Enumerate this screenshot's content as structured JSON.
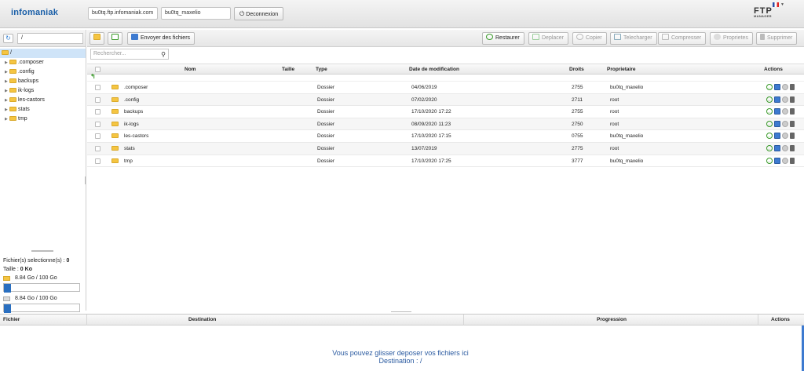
{
  "header": {
    "logo": "infomaniak",
    "host": "bu0tq.ftp.infomaniak.com",
    "user": "bu0tq_maxelio",
    "logout_label": "Deconnexion",
    "ftp_title": "FTP",
    "ftp_subtitle": "MANAGER"
  },
  "left": {
    "path": "/",
    "root_label": "/",
    "tree": [
      ".composer",
      ".config",
      "backups",
      "ik-logs",
      "les-castors",
      "stats",
      "tmp"
    ],
    "selected_label": "Fichier(s) selectionne(s) :",
    "selected_count": "0",
    "size_label": "Taille :",
    "size_value": "0 Ko",
    "quota1": "8.84 Go / 100 Go",
    "quota2": "8.84 Go / 100 Go",
    "quota1_fraction": 0.09,
    "quota2_fraction": 0.09
  },
  "toolbar": {
    "upload": "Envoyer des fichiers",
    "restore": "Restaurer",
    "move": "Deplacer",
    "copy": "Copier",
    "download": "Telecharger",
    "compress": "Compresser",
    "properties": "Proprietes",
    "delete": "Supprimer"
  },
  "search": {
    "placeholder": "Rechercher..."
  },
  "columns": {
    "name": "Nom",
    "size": "Taille",
    "type": "Type",
    "date": "Date de modification",
    "rights": "Droits",
    "owner": "Proprietaire",
    "actions": "Actions"
  },
  "rows": [
    {
      "name": ".composer",
      "type": "Dossier",
      "date": "04/06/2019",
      "rights": "2755",
      "owner": "bu0tq_maxelio"
    },
    {
      "name": ".config",
      "type": "Dossier",
      "date": "07/02/2020",
      "rights": "2711",
      "owner": "root"
    },
    {
      "name": "backups",
      "type": "Dossier",
      "date": "17/10/2020 17:22",
      "rights": "2755",
      "owner": "root"
    },
    {
      "name": "ik-logs",
      "type": "Dossier",
      "date": "08/09/2020 11:23",
      "rights": "2750",
      "owner": "root"
    },
    {
      "name": "les-castors",
      "type": "Dossier",
      "date": "17/10/2020 17:15",
      "rights": "0755",
      "owner": "bu0tq_maxelio"
    },
    {
      "name": "stats",
      "type": "Dossier",
      "date": "13/07/2019",
      "rights": "2775",
      "owner": "root"
    },
    {
      "name": "tmp",
      "type": "Dossier",
      "date": "17/10/2020 17:25",
      "rights": "3777",
      "owner": "bu0tq_maxelio"
    }
  ],
  "transfer": {
    "file": "Fichier",
    "destination": "Destination",
    "progress": "Progression",
    "actions": "Actions",
    "drop_line1": "Vous pouvez glisser deposer vos fichiers ici",
    "drop_line2": "Destination : /"
  },
  "colors": {
    "accent": "#2a6fc0",
    "folder": "#f5c542",
    "selected_row": "#cfe4f8"
  }
}
